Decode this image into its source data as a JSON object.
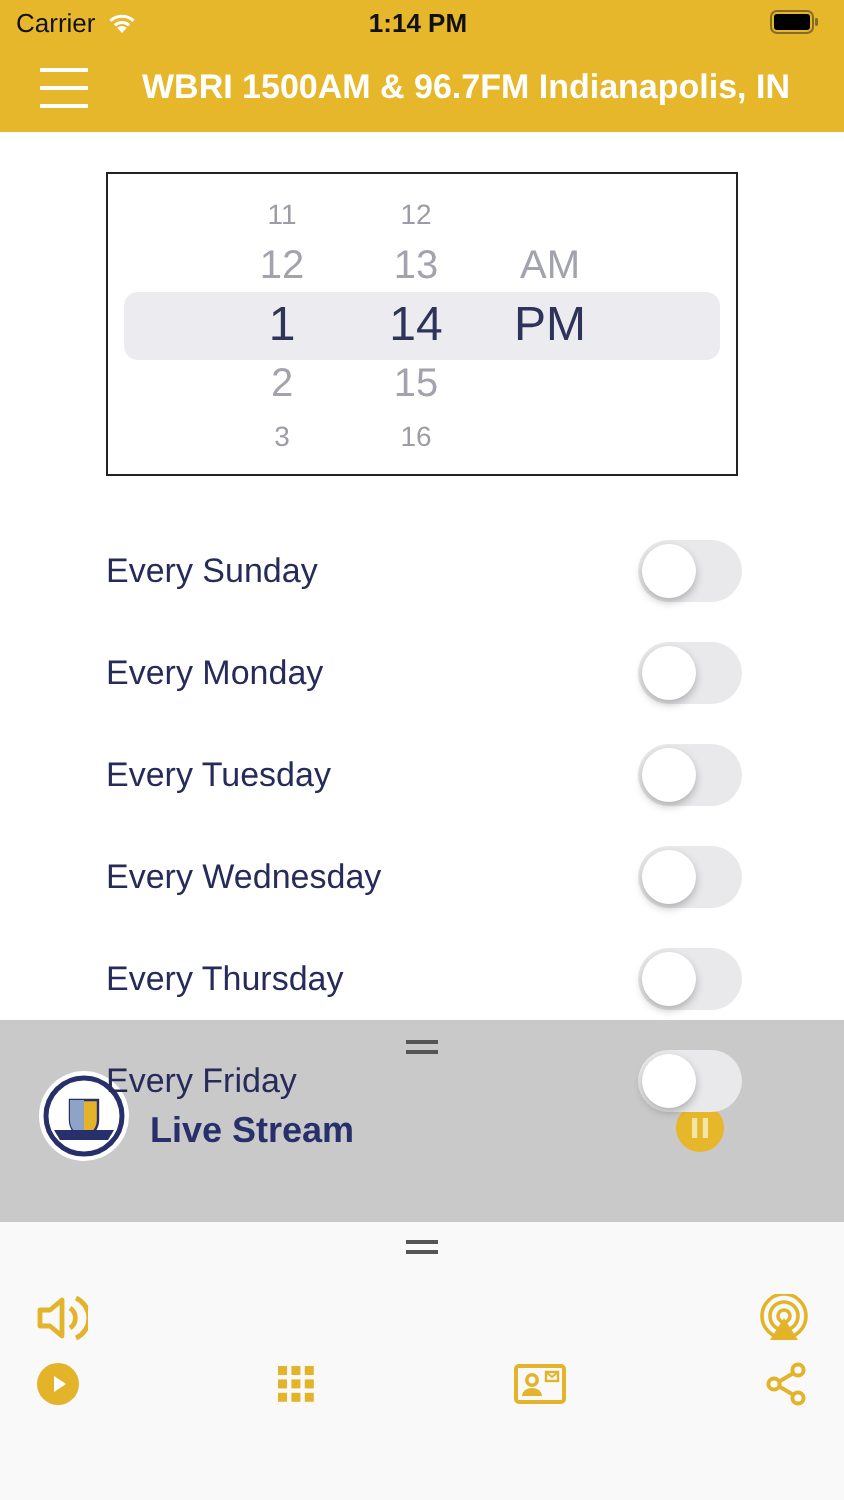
{
  "status_bar": {
    "carrier": "Carrier",
    "time": "1:14 PM"
  },
  "header": {
    "title": "WBRI 1500AM & 96.7FM Indianapolis, IN"
  },
  "time_picker": {
    "columns": [
      {
        "items": [
          {
            "label": "11",
            "selected": false
          },
          {
            "label": "12",
            "selected": false
          },
          {
            "label": "1",
            "selected": true
          },
          {
            "label": "2",
            "selected": false
          },
          {
            "label": "3",
            "selected": false
          }
        ]
      },
      {
        "items": [
          {
            "label": "12",
            "selected": false
          },
          {
            "label": "13",
            "selected": false
          },
          {
            "label": "14",
            "selected": true
          },
          {
            "label": "15",
            "selected": false
          },
          {
            "label": "16",
            "selected": false
          }
        ]
      },
      {
        "items": [
          {
            "label": "AM",
            "selected": false
          },
          {
            "label": "PM",
            "selected": true
          }
        ]
      }
    ]
  },
  "alarms": [
    {
      "label": "Every Sunday",
      "on": false
    },
    {
      "label": "Every Monday",
      "on": false
    },
    {
      "label": "Every Tuesday",
      "on": false
    },
    {
      "label": "Every Wednesday",
      "on": false
    },
    {
      "label": "Every Thursday",
      "on": false
    },
    {
      "label": "Every Friday",
      "on": false
    }
  ],
  "player": {
    "title": "Live Stream",
    "playing": true
  }
}
